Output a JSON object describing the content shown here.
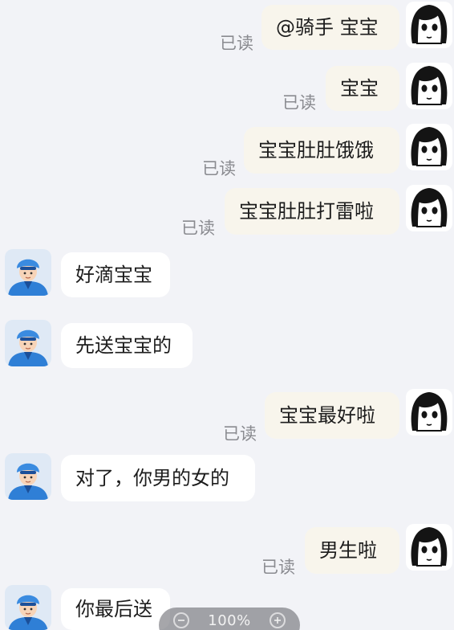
{
  "conversation": {
    "read_label": "已读",
    "messages": [
      {
        "sender": "me",
        "text": "@骑手 宝宝",
        "read": "已读"
      },
      {
        "sender": "me",
        "text": "宝宝",
        "read": "已读"
      },
      {
        "sender": "me",
        "text": "宝宝肚肚饿饿",
        "read": "已读"
      },
      {
        "sender": "me",
        "text": "宝宝肚肚打雷啦",
        "read": "已读"
      },
      {
        "sender": "rider",
        "text": "好滴宝宝"
      },
      {
        "sender": "rider",
        "text": "先送宝宝的"
      },
      {
        "sender": "me",
        "text": "宝宝最好啦",
        "read": "已读"
      },
      {
        "sender": "rider",
        "text": "对了，你男的女的"
      },
      {
        "sender": "me",
        "text": "男生啦",
        "read": "已读"
      },
      {
        "sender": "rider",
        "text": "你最后送"
      }
    ]
  },
  "zoom": {
    "level": "100%",
    "minus_icon": "zoom-out-icon",
    "plus_icon": "zoom-in-icon"
  },
  "colors": {
    "my_bubble": "#f8f5ec",
    "rider_bubble": "#ffffff",
    "background": "#f2f3f7",
    "read_text": "#8a8b90",
    "rider_uniform": "#2f7fd6"
  }
}
